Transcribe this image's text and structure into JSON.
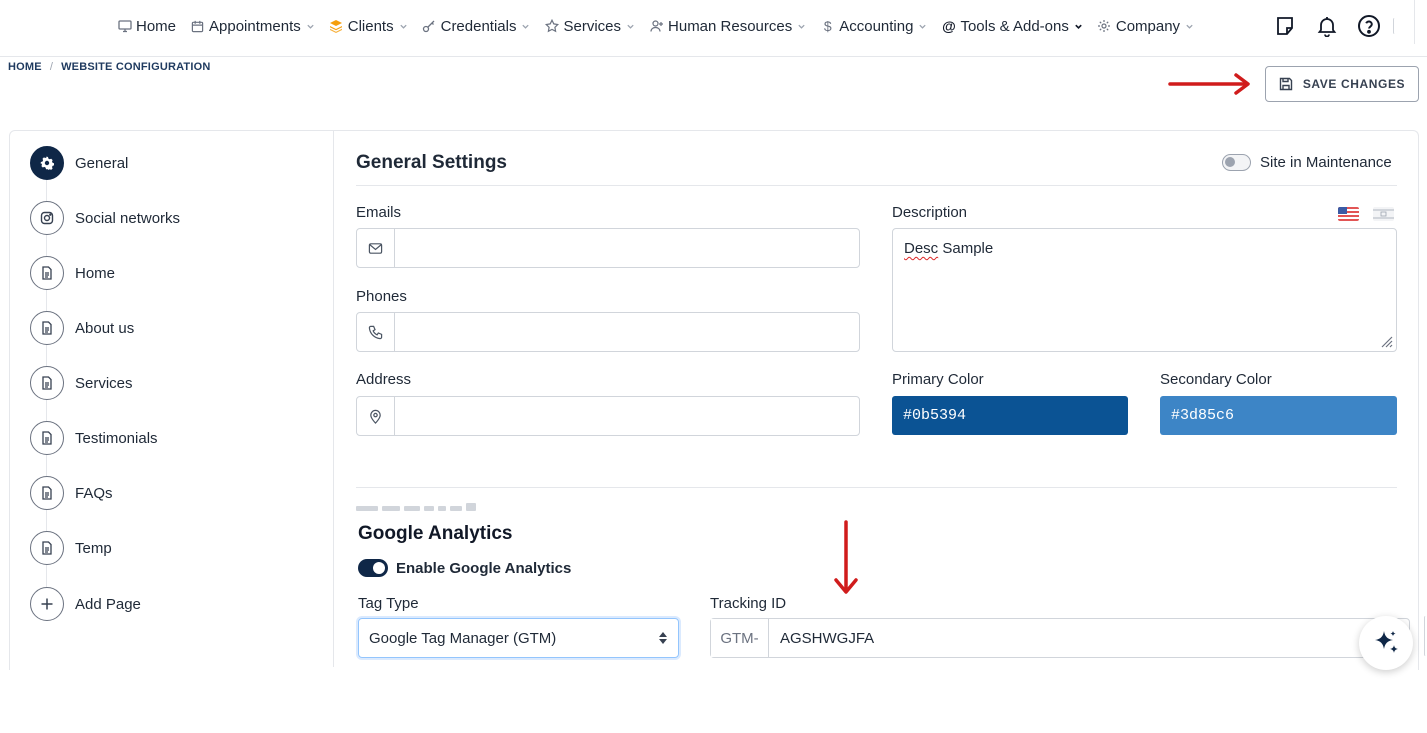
{
  "nav": {
    "items": [
      {
        "label": "Home",
        "icon": "monitor-icon",
        "chevron": false
      },
      {
        "label": "Appointments",
        "icon": "calendar-icon",
        "chevron": true
      },
      {
        "label": "Clients",
        "icon": "layers-icon",
        "chevron": true
      },
      {
        "label": "Credentials",
        "icon": "key-icon",
        "chevron": true
      },
      {
        "label": "Services",
        "icon": "star-icon",
        "chevron": true
      },
      {
        "label": "Human Resources",
        "icon": "user-plus-icon",
        "chevron": true
      },
      {
        "label": "Accounting",
        "icon": "dollar-icon",
        "chevron": true
      },
      {
        "label": "Tools & Add-ons",
        "icon": "at-icon",
        "chevron": true
      },
      {
        "label": "Company",
        "icon": "gear-icon",
        "chevron": true
      }
    ]
  },
  "breadcrumb": {
    "home": "HOME",
    "sep": "/",
    "current": "WEBSITE CONFIGURATION"
  },
  "toolbar": {
    "save_label": "SAVE CHANGES"
  },
  "sidebar": {
    "items": [
      {
        "label": "General",
        "icon": "gear-icon",
        "active": true
      },
      {
        "label": "Social networks",
        "icon": "instagram-icon",
        "active": false
      },
      {
        "label": "Home",
        "icon": "document-icon",
        "active": false
      },
      {
        "label": "About us",
        "icon": "document-icon",
        "active": false
      },
      {
        "label": "Services",
        "icon": "document-icon",
        "active": false
      },
      {
        "label": "Testimonials",
        "icon": "document-icon",
        "active": false
      },
      {
        "label": "FAQs",
        "icon": "document-icon",
        "active": false
      },
      {
        "label": "Temp",
        "icon": "document-icon",
        "active": false
      },
      {
        "label": "Add Page",
        "icon": "plus-icon",
        "active": false
      }
    ]
  },
  "general": {
    "title": "General Settings",
    "maintenance_label": "Site in Maintenance",
    "maintenance_on": false,
    "emails_label": "Emails",
    "emails_value": "",
    "phones_label": "Phones",
    "phones_value": "",
    "address_label": "Address",
    "address_value": "",
    "description_label": "Description",
    "description_value_w1": "Desc",
    "description_value_w2": " Sample",
    "primary_color_label": "Primary Color",
    "primary_color": "#0b5394",
    "secondary_color_label": "Secondary Color",
    "secondary_color": "#3d85c6"
  },
  "analytics": {
    "title": "Google Analytics",
    "enable_label": "Enable Google Analytics",
    "enabled": true,
    "tag_type_label": "Tag Type",
    "tag_type_value": "Google Tag Manager (GTM)",
    "tracking_label": "Tracking ID",
    "tracking_prefix": "GTM-",
    "tracking_value": "AGSHWGJFA"
  },
  "colors": {
    "navy": "#0f2747",
    "annotation_red": "#d01c1c"
  }
}
